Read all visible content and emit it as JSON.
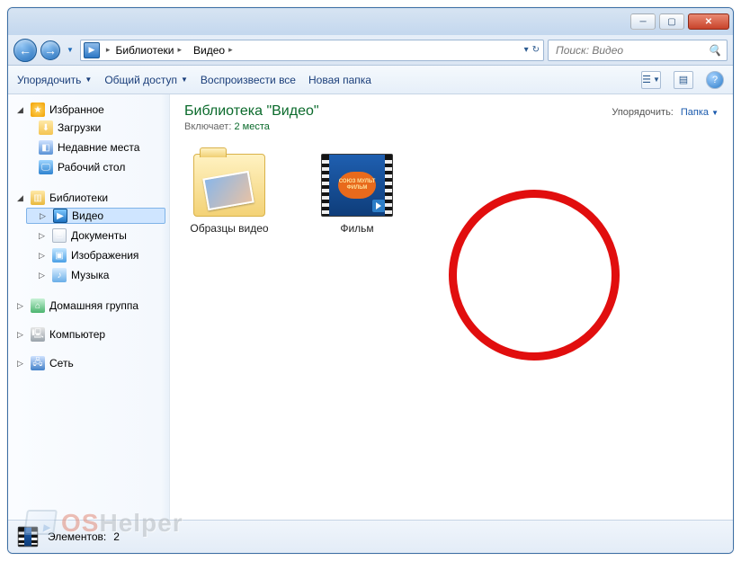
{
  "breadcrumbs": [
    "Библиотеки",
    "Видео"
  ],
  "search": {
    "placeholder": "Поиск: Видео"
  },
  "toolbar": {
    "organize": "Упорядочить",
    "share": "Общий доступ",
    "playAll": "Воспроизвести все",
    "newFolder": "Новая папка"
  },
  "sidebar": {
    "favorites": {
      "label": "Избранное",
      "items": [
        {
          "label": "Загрузки"
        },
        {
          "label": "Недавние места"
        },
        {
          "label": "Рабочий стол"
        }
      ]
    },
    "libraries": {
      "label": "Библиотеки",
      "items": [
        {
          "label": "Видео",
          "selected": true
        },
        {
          "label": "Документы"
        },
        {
          "label": "Изображения"
        },
        {
          "label": "Музыка"
        }
      ]
    },
    "homegroup": {
      "label": "Домашняя группа"
    },
    "computer": {
      "label": "Компьютер"
    },
    "network": {
      "label": "Сеть"
    }
  },
  "content": {
    "title": "Библиотека \"Видео\"",
    "includesLabel": "Включает:",
    "includesCount": "2 места",
    "arrangeLabel": "Упорядочить:",
    "arrangeValue": "Папка",
    "items": [
      {
        "name": "Образцы видео",
        "kind": "folder"
      },
      {
        "name": "Фильм",
        "kind": "video",
        "badgeText": "СОЮЗ\nМУЛЬТ\nФИЛЬМ"
      }
    ]
  },
  "status": {
    "elementsLabel": "Элементов:",
    "elementsCount": "2"
  },
  "watermark": {
    "brand": "OSHelper"
  }
}
